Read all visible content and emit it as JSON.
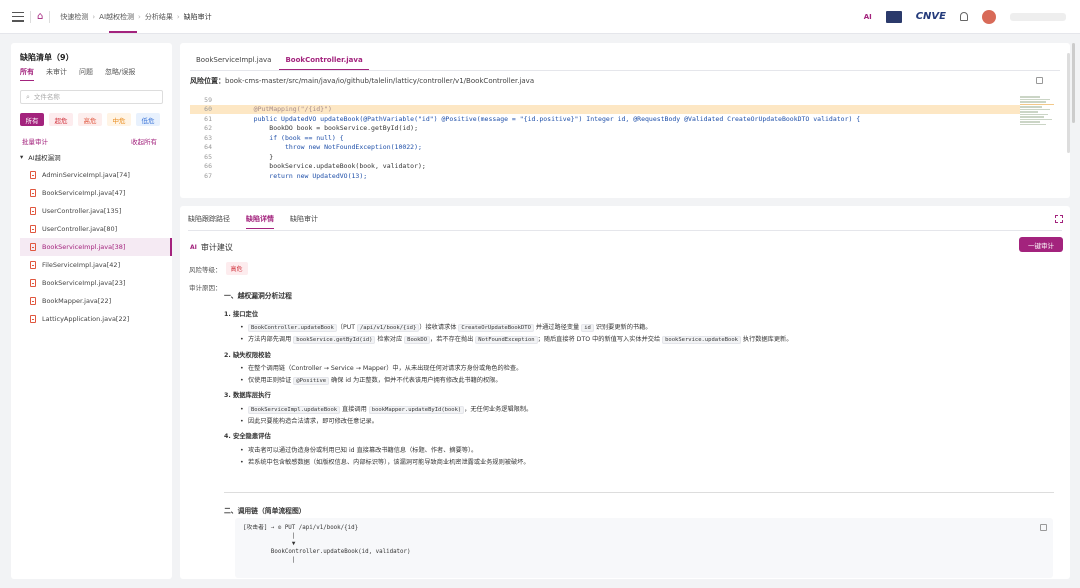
{
  "topbar": {
    "breadcrumbs": [
      "快速检测",
      "AI越权检测",
      "分析结果",
      "缺陷审计"
    ],
    "ai_badge": "AI",
    "logo_text": "CNVE"
  },
  "left": {
    "title": "缺陷清单（9）",
    "tabs": [
      "所有",
      "未审计",
      "问题",
      "忽略/误报"
    ],
    "search_placeholder": "文件名称",
    "severity": [
      "所有",
      "超危",
      "高危",
      "中危",
      "低危"
    ],
    "bulk_audit": "批量审计",
    "collapse_all": "收起所有",
    "group": "AI越权漏洞",
    "files": [
      "AdminServiceImpl.java[74]",
      "BookServiceImpl.java[47]",
      "UserController.java[135]",
      "UserController.java[80]",
      "BookServiceImpl.java[38]",
      "FileServiceImpl.java[42]",
      "BookServiceImpl.java[23]",
      "BookMapper.java[22]",
      "LatticyApplication.java[22]"
    ]
  },
  "editor": {
    "tabs": [
      "BookServiceImpl.java",
      "BookController.java"
    ],
    "risk_label": "风险位置：",
    "risk_path": "book-cms-master/src/main/java/io/github/talelin/latticy/controller/v1/BookController.java",
    "lines": [
      {
        "n": "59",
        "text": ""
      },
      {
        "n": "60",
        "text": "    @PutMapping(\"/{id}\")"
      },
      {
        "n": "61",
        "text": "    public UpdatedVO updateBook(@PathVariable(\"id\") @Positive(message = \"{id.positive}\") Integer id, @RequestBody @Validated CreateOrUpdateBookDTO validator) {"
      },
      {
        "n": "62",
        "text": "        BookDO book = bookService.getById(id);"
      },
      {
        "n": "63",
        "text": "        if (book == null) {"
      },
      {
        "n": "64",
        "text": "            throw new NotFoundException(10022);"
      },
      {
        "n": "65",
        "text": "        }"
      },
      {
        "n": "66",
        "text": "        bookService.updateBook(book, validator);"
      },
      {
        "n": "67",
        "text": "        return new UpdatedVO(13);"
      }
    ]
  },
  "detail": {
    "tabs": [
      "缺陷跟踪路径",
      "缺陷详情",
      "缺陷审计"
    ],
    "audit_title": "审计建议",
    "ai_tag": "AI",
    "one_click": "一键审计",
    "risk_level_label": "风险等级：",
    "risk_level": "高危",
    "reason_label": "审计原因：",
    "section1": "一、越权漏洞分析过程",
    "s1_h1": "1. 接口定位",
    "s1_h1_li1_a": "BookController.updateBook",
    "s1_h1_li1_b": "（PUT ",
    "s1_h1_li1_c": "/api/v1/book/{id}",
    "s1_h1_li1_d": "）接收请求体 ",
    "s1_h1_li1_e": "CreateOrUpdateBookDTO",
    "s1_h1_li1_f": " 并通过路径变量 ",
    "s1_h1_li1_g": "id",
    "s1_h1_li1_h": " 识别要更新的书籍。",
    "s1_h1_li2_a": "方法内部先调用 ",
    "s1_h1_li2_b": "bookService.getById(id)",
    "s1_h1_li2_c": " 检索对应 ",
    "s1_h1_li2_d": "BookDO",
    "s1_h1_li2_e": "，若不存在抛出 ",
    "s1_h1_li2_f": "NotFoundException",
    "s1_h1_li2_g": "；随后直接将 DTO 中的新值写入实体并交给 ",
    "s1_h1_li2_h": "bookService.updateBook",
    "s1_h1_li2_i": " 执行数据库更新。",
    "s1_h2": "2. 缺失权限校验",
    "s1_h2_li1": "在整个调用链（Controller → Service → Mapper）中，从未出现任何对请求方身份或角色的检查。",
    "s1_h2_li2_a": "仅使用正则验证 ",
    "s1_h2_li2_b": "@Positive",
    "s1_h2_li2_c": " 确保 id 为正整数，但并不代表该用户拥有修改此书籍的权限。",
    "s1_h3": "3. 数据库层执行",
    "s1_h3_li1_a": "BookServiceImpl.updateBook",
    "s1_h3_li1_b": " 直接调用 ",
    "s1_h3_li1_c": "bookMapper.updateById(book)",
    "s1_h3_li1_d": "，无任何业务逻辑限制。",
    "s1_h3_li2": "因此只要能构造合法请求，即可修改任意记录。",
    "s1_h4": "4. 安全隐患评估",
    "s1_h4_li1": "攻击者可以通过伪造身份或利用已知 id 直接篡改书籍信息（标题、作者、摘要等）。",
    "s1_h4_li2": "若系统中包含敏感数据（如版权信息、内部标识等），该漏洞可能导致商业机密泄露或业务规则被破坏。",
    "section2": "二、调用链（简单流程图）",
    "call_chain": "[攻击者] → ⊙ PUT /api/v1/book/{id}\n              |\n              ▼\n        BookController.updateBook(id, validator)\n              |"
  }
}
